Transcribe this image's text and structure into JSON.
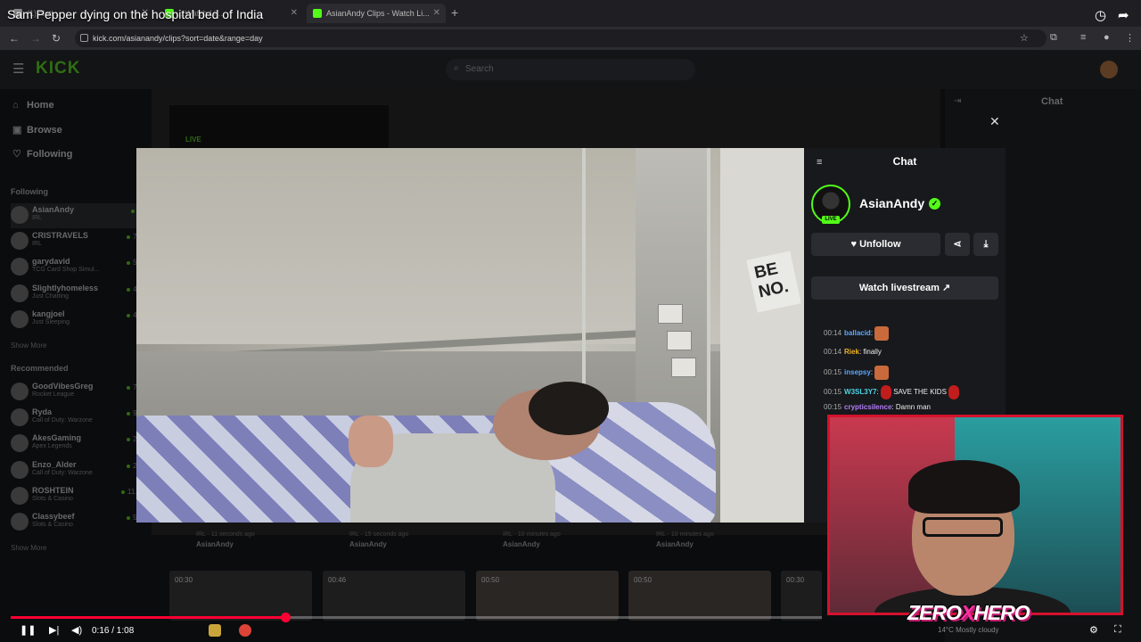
{
  "video": {
    "title": "Sam Pepper dying on the hospital bed of India",
    "time": "0:16 / 1:08",
    "progress": 0.338,
    "sign_text": "BE NO."
  },
  "browser": {
    "tabs": [
      {
        "label": "(1) Noti..."
      },
      {
        "label": "...Watch Li..."
      },
      {
        "label": "AsianAndy Clips - Watch Li..."
      }
    ],
    "url": "kick.com/asianandy/clips?sort=date&range=day"
  },
  "kick": {
    "logo": "KICK",
    "search_placeholder": "Search",
    "nav": [
      {
        "label": "Home",
        "icon": "home-icon"
      },
      {
        "label": "Browse",
        "icon": "compass-icon"
      },
      {
        "label": "Following",
        "icon": "heart-icon"
      }
    ],
    "following_heading": "Following",
    "following": [
      {
        "name": "AsianAndy",
        "category": "IRL",
        "viewers": "2"
      },
      {
        "name": "CRISTRAVELS",
        "category": "IRL",
        "viewers": "73"
      },
      {
        "name": "garydavid",
        "category": "TCG Card Shop Simul...",
        "viewers": "53"
      },
      {
        "name": "Slightlyhomeless",
        "category": "Just Chatting",
        "viewers": "45"
      },
      {
        "name": "kangjoel",
        "category": "Just Sleeping",
        "viewers": "47"
      }
    ],
    "show_more": "Show More",
    "recommended_heading": "Recommended",
    "recommended": [
      {
        "name": "GoodVibesGreg",
        "category": "Rocket League",
        "viewers": "75"
      },
      {
        "name": "Ryda",
        "category": "Call of Duty: Warzone",
        "viewers": "94"
      },
      {
        "name": "AkesGaming",
        "category": "Apex Legends",
        "viewers": "26"
      },
      {
        "name": "Enzo_Alder",
        "category": "Call of Duty: Warzone",
        "viewers": "23"
      },
      {
        "name": "ROSHTEIN",
        "category": "Slots & Casino",
        "viewers": "11.4"
      },
      {
        "name": "Classybeef",
        "category": "Slots & Casino",
        "viewers": "51"
      }
    ],
    "live_badge": "LIVE",
    "right_chat_title": "Chat",
    "clips_meta": [
      {
        "time": "IRL · 11 seconds ago",
        "author": "AsianAndy"
      },
      {
        "time": "IRL · 15 seconds ago",
        "author": "AsianAndy"
      },
      {
        "time": "IRL · 10 minutes ago",
        "author": "AsianAndy"
      },
      {
        "time": "IRL · 10 minutes ago",
        "author": "AsianAndy"
      }
    ],
    "thumbs": [
      "00:30",
      "00:46",
      "00:50",
      "00:50",
      "00:30"
    ]
  },
  "chat_panel": {
    "title": "Chat",
    "streamer": "AsianAndy",
    "live": "LIVE",
    "unfollow": "Unfollow",
    "watch_livestream": "Watch livestream",
    "messages": [
      {
        "time": "00:14",
        "user": "ballacid",
        "color": "#5aa7ff",
        "text": "",
        "emote": true
      },
      {
        "time": "00:14",
        "user": "Riek",
        "color": "#f0b429",
        "text": "finally",
        "emote": false
      },
      {
        "time": "00:15",
        "user": "insepsy",
        "color": "#5aa7ff",
        "text": "",
        "emote": true
      },
      {
        "time": "00:15",
        "user": "W3SL3Y7",
        "color": "#4cd4e6",
        "text": "SAVE THE KIDS",
        "emote": false
      },
      {
        "time": "00:15",
        "user": "crypticsilence",
        "color": "#b27cf7",
        "text": "Damn man",
        "emote": false
      }
    ]
  },
  "overlay": {
    "logo_left": "ZERO",
    "logo_x": "X",
    "logo_right": "HERO"
  },
  "taskbar": {
    "weather": "14°C Mostly cloudy"
  }
}
